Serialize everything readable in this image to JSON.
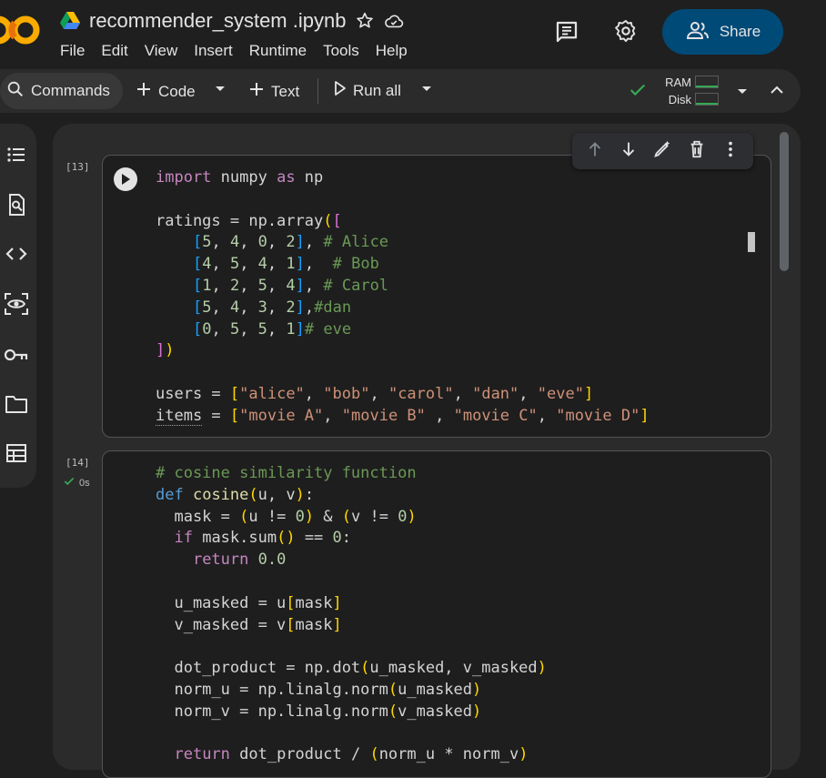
{
  "header": {
    "notebook_title": "recommender_system .ipynb",
    "menu": [
      "File",
      "Edit",
      "View",
      "Insert",
      "Runtime",
      "Tools",
      "Help"
    ],
    "share_label": "Share"
  },
  "toolbar": {
    "commands_label": "Commands",
    "code_label": "Code",
    "text_label": "Text",
    "run_all_label": "Run all",
    "ram_label": "RAM",
    "disk_label": "Disk"
  },
  "cells": [
    {
      "exec_count": "[13]",
      "code_lines": [
        "import numpy as np",
        "",
        "ratings = np.array([",
        "    [5, 4, 0, 2], # Alice",
        "    [4, 5, 4, 1],  # Bob",
        "    [1, 2, 5, 4], # Carol",
        "    [5, 4, 3, 2],#dan",
        "    [0, 5, 5, 1]# eve",
        "])",
        "",
        "users = [\"alice\", \"bob\", \"carol\", \"dan\", \"eve\"]",
        "items = [\"movie A\", \"movie B\" , \"movie C\", \"movie D\"]"
      ]
    },
    {
      "exec_count": "[14]",
      "status": "0s",
      "code_lines": [
        "# cosine similarity function",
        "def cosine(u, v):",
        "  mask = (u != 0) & (v != 0)",
        "  if mask.sum() == 0:",
        "    return 0.0",
        "",
        "  u_masked = u[mask]",
        "  v_masked = v[mask]",
        "",
        "  dot_product = np.dot(u_masked, v_masked)",
        "  norm_u = np.linalg.norm(u_masked)",
        "  norm_v = np.linalg.norm(v_masked)",
        "",
        "  return dot_product / (norm_u * norm_v)"
      ]
    }
  ],
  "colors": {
    "share_bg": "#004a77",
    "keyword": "#c586c0",
    "string": "#ce9178",
    "comment": "#6a9955",
    "status_ok": "#34a853"
  },
  "icons": [
    "colab-logo-icon",
    "drive-icon",
    "star-icon",
    "cloud-saved-icon",
    "comment-icon",
    "gear-icon",
    "people-icon",
    "search-icon",
    "plus-icon",
    "play-icon",
    "chevron-down-icon",
    "check-icon",
    "chevron-up-icon",
    "toc-icon",
    "find-icon",
    "code-snippets-icon",
    "variables-icon",
    "key-icon",
    "folder-icon",
    "table-icon",
    "arrow-up-icon",
    "arrow-down-icon",
    "edit-icon",
    "delete-icon",
    "more-vert-icon"
  ]
}
